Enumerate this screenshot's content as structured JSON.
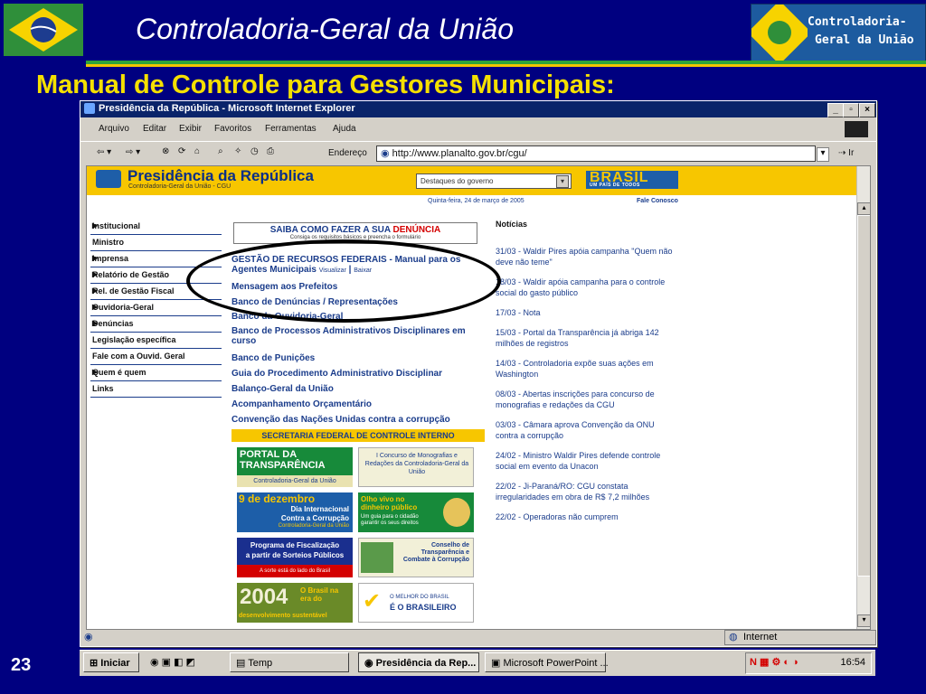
{
  "slide": {
    "title": "Controladoria-Geral da União",
    "subtitle": "Manual de Controle para Gestores Municipais:",
    "number": "23",
    "logo_text_line1": "Controladoria-",
    "logo_text_line2": "Geral da União"
  },
  "browser": {
    "title": "Presidência da República - Microsoft Internet Explorer",
    "controls": {
      "minimize": "_",
      "restore": "▫",
      "close": "×"
    },
    "menu": [
      "Arquivo",
      "Editar",
      "Exibir",
      "Favoritos",
      "Ferramentas",
      "Ajuda"
    ],
    "address_label": "Endereço",
    "address": "http://www.planalto.gov.br/cgu/",
    "go_label": "Ir",
    "status": {
      "zone": "Internet"
    }
  },
  "site": {
    "title": "Presidência da República",
    "subtitle": "Controladoria-Geral da União - CGU",
    "destaques": "Destaques do governo",
    "brasil": "BRASIL",
    "brasil_sub": "UM PAÍS DE TODOS",
    "date": "Quinta-feira, 24 de março de 2005",
    "fale": "Fale Conosco",
    "nav": [
      {
        "label": "Institucional",
        "arrow": true
      },
      {
        "label": "Ministro",
        "arrow": false
      },
      {
        "label": "Imprensa",
        "arrow": true
      },
      {
        "label": "Relatório de Gestão",
        "arrow": true
      },
      {
        "label": "Rel. de Gestão Fiscal",
        "arrow": true
      },
      {
        "label": "Ouvidoria-Geral",
        "arrow": true
      },
      {
        "label": "Denúncias",
        "arrow": true
      },
      {
        "label": "Legislação específica",
        "arrow": false
      },
      {
        "label": "Fale com a Ouvid. Geral",
        "arrow": false
      },
      {
        "label": "Quem é quem",
        "arrow": true
      },
      {
        "label": "Links",
        "arrow": false
      }
    ],
    "saiba": "SAIBA COMO FAZER A SUA",
    "saiba_denuncia": "DENÚNCIA",
    "saiba_small": "Consiga os requisitos básicos e preencha o formulário",
    "list": [
      "GESTÃO DE RECURSOS FEDERAIS - Manual para os Agentes Municipais",
      "Mensagem aos Prefeitos",
      "Banco de Denúncias / Representações",
      "Banco da Ouvidoria-Geral",
      "Banco de Processos Administrativos Disciplinares em curso",
      "Banco de Punições",
      "Guia do Procedimento Administrativo Disciplinar",
      "Balanço-Geral da União",
      "Acompanhamento Orçamentário",
      "Convenção das Nações Unidas contra a corrupção"
    ],
    "links_extra": [
      "Visualizar",
      "Baixar"
    ],
    "secretaria": "SECRETARIA FEDERAL DE CONTROLE INTERNO",
    "banners": {
      "portal_line1": "PORTAL DA",
      "portal_line2": "TRANSPARÊNCIA",
      "portal_line3": "Controladoria-Geral da União",
      "concurso": "I Concurso de Monografias e Redações da Controladoria-Geral da União",
      "dez_title": "9 de dezembro",
      "dez_sub1": "Dia Internacional",
      "dez_sub2": "Contra a Corrupção",
      "dez_sub3": "Controladoria-Geral da União",
      "olho_title": "Olho vivo no dinheiro público",
      "olho_sub": "Um guia para o cidadão garantir os seus direitos",
      "prog1": "Programa de Fiscalização",
      "prog2": "a partir de Sorteios Públicos",
      "prog3": "A sorte está do lado do Brasil",
      "conselho": "Conselho de Transparência e Combate à Corrupção",
      "y2004": "2004",
      "y2004_sub": "O Brasil na era do",
      "y2004_sub2": "desenvolvimento sustentável",
      "melhor1": "O MELHOR DO BRASIL",
      "melhor2": "É O BRASILEIRO"
    },
    "news_title": "Notícias",
    "news": [
      "31/03 - Waldir Pires apóia campanha \"Quem não deve não teme\"",
      "18/03 - Waldir apóia campanha para o controle social do gasto público",
      "17/03 - Nota",
      "15/03 - Portal da Transparência já abriga 142 milhões de registros",
      "14/03 - Controladoria expõe suas ações em Washington",
      "08/03 - Abertas inscrições para concurso de monografias e redações da CGU",
      "03/03 - Câmara aprova Convenção da ONU contra a corrupção",
      "24/02 - Ministro Waldir Pires defende controle social em evento da Unacon",
      "22/02 - Ji-Paraná/RO: CGU constata irregularidades em obra de R$ 7,2 milhões",
      "22/02 - Operadoras não cumprem"
    ]
  },
  "taskbar": {
    "start": "Iniciar",
    "items": [
      "Temp",
      "Presidência da Rep...",
      "Microsoft PowerPoint ..."
    ],
    "time": "16:54"
  }
}
